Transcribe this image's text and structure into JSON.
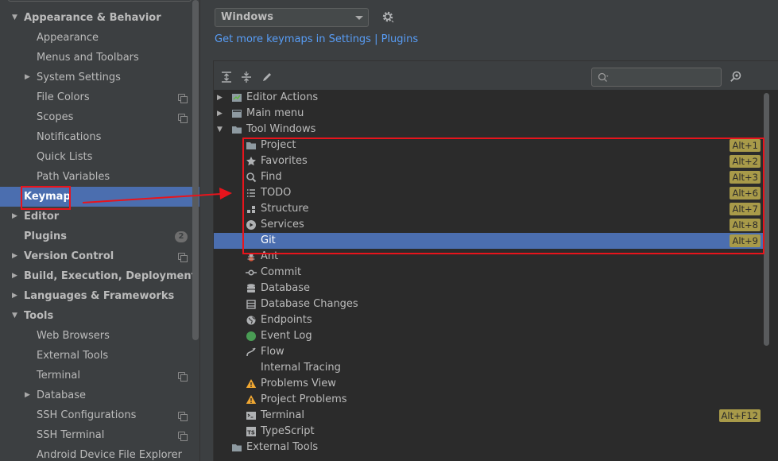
{
  "sidebar": {
    "items": [
      {
        "label": "Appearance & Behavior",
        "level": 0,
        "bold": true,
        "expanded": true,
        "copy": false
      },
      {
        "label": "Appearance",
        "level": 1,
        "bold": false,
        "copy": false
      },
      {
        "label": "Menus and Toolbars",
        "level": 1,
        "bold": false,
        "copy": false
      },
      {
        "label": "System Settings",
        "level": 1,
        "bold": false,
        "collapsed": true,
        "copy": false
      },
      {
        "label": "File Colors",
        "level": 1,
        "bold": false,
        "copy": true
      },
      {
        "label": "Scopes",
        "level": 1,
        "bold": false,
        "copy": true
      },
      {
        "label": "Notifications",
        "level": 1,
        "bold": false,
        "copy": false
      },
      {
        "label": "Quick Lists",
        "level": 1,
        "bold": false,
        "copy": false
      },
      {
        "label": "Path Variables",
        "level": 1,
        "bold": false,
        "copy": false
      },
      {
        "label": "Keymap",
        "level": 0,
        "bold": true,
        "selected": true,
        "copy": false
      },
      {
        "label": "Editor",
        "level": 0,
        "bold": true,
        "collapsed": true,
        "copy": false
      },
      {
        "label": "Plugins",
        "level": 0,
        "bold": true,
        "badge": "2",
        "copy": false
      },
      {
        "label": "Version Control",
        "level": 0,
        "bold": true,
        "collapsed": true,
        "copy": true
      },
      {
        "label": "Build, Execution, Deployment",
        "level": 0,
        "bold": true,
        "collapsed": true,
        "copy": false
      },
      {
        "label": "Languages & Frameworks",
        "level": 0,
        "bold": true,
        "collapsed": true,
        "copy": false
      },
      {
        "label": "Tools",
        "level": 0,
        "bold": true,
        "expanded": true,
        "copy": false
      },
      {
        "label": "Web Browsers",
        "level": 1,
        "bold": false,
        "copy": false
      },
      {
        "label": "External Tools",
        "level": 1,
        "bold": false,
        "copy": false
      },
      {
        "label": "Terminal",
        "level": 1,
        "bold": false,
        "copy": true
      },
      {
        "label": "Database",
        "level": 1,
        "bold": false,
        "collapsed": true,
        "copy": false
      },
      {
        "label": "SSH Configurations",
        "level": 1,
        "bold": false,
        "copy": true
      },
      {
        "label": "SSH Terminal",
        "level": 1,
        "bold": false,
        "copy": true
      },
      {
        "label": "Android Device File Explorer",
        "level": 1,
        "bold": false,
        "copy": false
      }
    ]
  },
  "keymap": {
    "selected_keymap": "Windows",
    "more_keymaps_link": "Get more keymaps in Settings | Plugins",
    "search_placeholder": ""
  },
  "tree": {
    "rows": [
      {
        "label": "Editor Actions",
        "level": 0,
        "toggle": "collapsed",
        "icon": "editor-actions-icon",
        "shortcut": ""
      },
      {
        "label": "Main menu",
        "level": 0,
        "toggle": "collapsed",
        "icon": "main-menu-icon",
        "shortcut": ""
      },
      {
        "label": "Tool Windows",
        "level": 0,
        "toggle": "expanded",
        "icon": "folder-icon",
        "shortcut": ""
      },
      {
        "label": "Project",
        "level": 1,
        "icon": "folder-icon",
        "shortcut": "Alt+1"
      },
      {
        "label": "Favorites",
        "level": 1,
        "icon": "star-icon",
        "shortcut": "Alt+2"
      },
      {
        "label": "Find",
        "level": 1,
        "icon": "search-icon",
        "shortcut": "Alt+3"
      },
      {
        "label": "TODO",
        "level": 1,
        "icon": "list-icon",
        "shortcut": "Alt+6"
      },
      {
        "label": "Structure",
        "level": 1,
        "icon": "structure-icon",
        "shortcut": "Alt+7"
      },
      {
        "label": "Services",
        "level": 1,
        "icon": "play-circle-icon",
        "shortcut": "Alt+8"
      },
      {
        "label": "Git",
        "level": 1,
        "icon": "",
        "shortcut": "Alt+9",
        "selected": true
      },
      {
        "label": "Ant",
        "level": 1,
        "icon": "ant-icon",
        "shortcut": ""
      },
      {
        "label": "Commit",
        "level": 1,
        "icon": "commit-icon",
        "shortcut": ""
      },
      {
        "label": "Database",
        "level": 1,
        "icon": "database-icon",
        "shortcut": ""
      },
      {
        "label": "Database Changes",
        "level": 1,
        "icon": "database-changes-icon",
        "shortcut": ""
      },
      {
        "label": "Endpoints",
        "level": 1,
        "icon": "globe-icon",
        "shortcut": ""
      },
      {
        "label": "Event Log",
        "level": 1,
        "icon": "event-log-icon",
        "shortcut": ""
      },
      {
        "label": "Flow",
        "level": 1,
        "icon": "flow-icon",
        "shortcut": ""
      },
      {
        "label": "Internal Tracing",
        "level": 1,
        "icon": "",
        "shortcut": ""
      },
      {
        "label": "Problems View",
        "level": 1,
        "icon": "warning-icon",
        "shortcut": ""
      },
      {
        "label": "Project Problems",
        "level": 1,
        "icon": "warning-icon",
        "shortcut": ""
      },
      {
        "label": "Terminal",
        "level": 1,
        "icon": "terminal-icon",
        "shortcut": "Alt+F12"
      },
      {
        "label": "TypeScript",
        "level": 1,
        "icon": "typescript-icon",
        "shortcut": ""
      },
      {
        "label": "External Tools",
        "level": 0,
        "toggle": "none",
        "icon": "folder-icon",
        "shortcut": ""
      }
    ]
  },
  "colors": {
    "selection": "#4b6eaf",
    "shortcut_badge": "#a89a49",
    "annotation": "#e8141c",
    "link": "#589df6"
  }
}
